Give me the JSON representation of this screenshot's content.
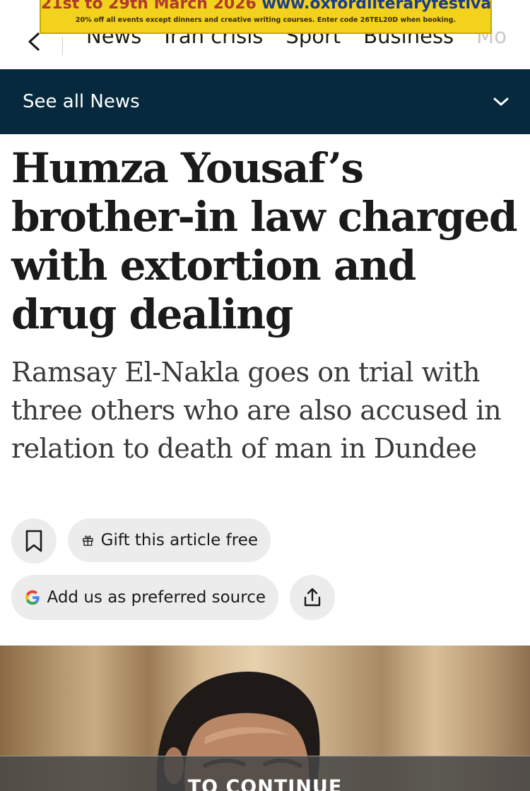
{
  "ad": {
    "line1_dates": "21st to 29th March 2026",
    "line1_url": "www.oxfordliteraryfestival.org",
    "line2": "20% off all events except dinners and creative writing courses. Enter code 26TEL20D when booking."
  },
  "nav": {
    "links": [
      "News",
      "Iran crisis",
      "Sport",
      "Business",
      "Mo"
    ]
  },
  "see_all": {
    "label": "See all News"
  },
  "article": {
    "headline": "Humza Yousaf’s brother-in law charged with extortion and drug dealing",
    "standfirst": "Ramsay El-Nakla goes on trial with three others who are also accused in relation to death of man in Dundee"
  },
  "actions": {
    "gift_label": "Gift this article free",
    "source_label": "Add us as preferred source"
  },
  "paywall": {
    "text": "TO CONTINUE"
  },
  "colors": {
    "bar_background": "#06293d",
    "button_background": "#ececec",
    "ad_background": "#f2d21c"
  }
}
